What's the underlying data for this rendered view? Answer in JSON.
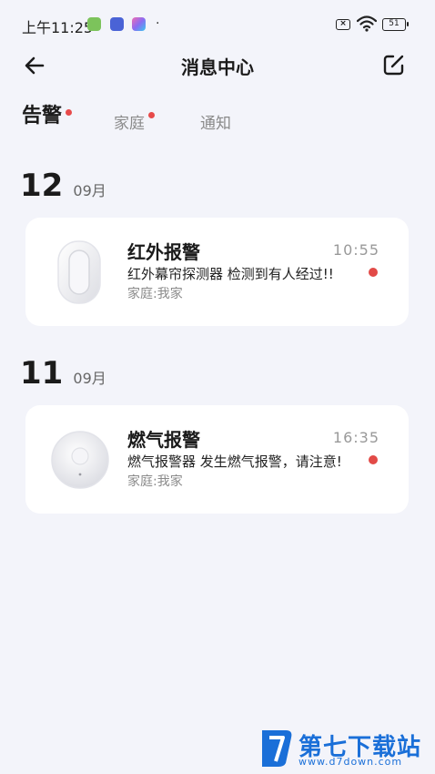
{
  "status_bar": {
    "time": "上午11:25",
    "dot": "·",
    "battery": "51",
    "icons": [
      "download-app-icon",
      "ai-app-icon",
      "gallery-app-icon",
      "no-sim-icon",
      "wifi-icon",
      "battery-icon"
    ],
    "x_mark": "×"
  },
  "header": {
    "title": "消息中心",
    "back_icon": "arrow-left-icon",
    "edit_icon": "edit-icon"
  },
  "tabs": [
    {
      "label": "告警",
      "active": true,
      "has_dot": true
    },
    {
      "label": "家庭",
      "active": false,
      "has_dot": true
    },
    {
      "label": "通知",
      "active": false,
      "has_dot": false
    }
  ],
  "groups": [
    {
      "day": "12",
      "month": "09月",
      "items": [
        {
          "name": "红外报警",
          "time": "10:55",
          "message": "红外幕帘探测器  检测到有人经过!!",
          "family": "家庭:我家",
          "unread": true,
          "thumb_icon": "infrared-sensor-icon"
        }
      ]
    },
    {
      "day": "11",
      "month": "09月",
      "items": [
        {
          "name": "燃气报警",
          "time": "16:35",
          "message": "燃气报警器  发生燃气报警，请注意!",
          "family": "家庭:我家",
          "unread": true,
          "thumb_icon": "gas-detector-icon"
        }
      ]
    }
  ],
  "watermark": {
    "text": "第七下载站",
    "url": "www.d7down.com"
  },
  "colors": {
    "background": "#f3f4fa",
    "card": "#ffffff",
    "unread_dot": "#e24a47",
    "tab_dot": "#e74a4a",
    "watermark": "#1a6fd8"
  }
}
